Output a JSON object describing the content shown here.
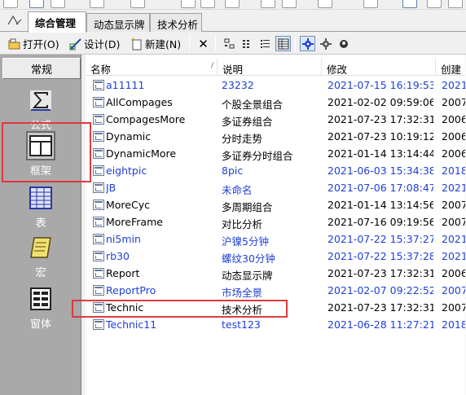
{
  "tabs": [
    "综合管理",
    "动态显示牌",
    "技术分析"
  ],
  "toolbar": {
    "open": "打开(O)",
    "design": "设计(D)",
    "new": "新建(N)"
  },
  "left_panel": {
    "header": "常规",
    "items": [
      "公式",
      "框架",
      "表",
      "宏",
      "窗体"
    ]
  },
  "columns": [
    "名称",
    "说明",
    "修改",
    "创建"
  ],
  "rows": [
    {
      "name": "a11111",
      "desc": "23232",
      "modified": "2021-07-15 16:19:53",
      "created": "2021-",
      "blue": true
    },
    {
      "name": "AllCompages",
      "desc": "个股全景组合",
      "modified": "2021-02-02 09:59:06",
      "created": "2007-",
      "blue": false
    },
    {
      "name": "CompagesMore",
      "desc": "多证券组合",
      "modified": "2021-07-23 17:32:31",
      "created": "2006-",
      "blue": false
    },
    {
      "name": "Dynamic",
      "desc": "分时走势",
      "modified": "2021-07-23 10:19:12",
      "created": "2006-",
      "blue": false
    },
    {
      "name": "DynamicMore",
      "desc": "多证券分时组合",
      "modified": "2021-01-14 13:14:44",
      "created": "2006-",
      "blue": false
    },
    {
      "name": "eightpic",
      "desc": "8pic",
      "modified": "2021-06-03 15:34:38",
      "created": "2018-",
      "blue": true
    },
    {
      "name": "JB",
      "desc": "未命名",
      "modified": "2021-07-06 17:08:47",
      "created": "2021-",
      "blue": true
    },
    {
      "name": "MoreCyc",
      "desc": "多周期组合",
      "modified": "2021-01-14 13:14:56",
      "created": "2007-",
      "blue": false
    },
    {
      "name": "MoreFrame",
      "desc": "对比分析",
      "modified": "2021-07-16 09:19:56",
      "created": "2007-",
      "blue": false
    },
    {
      "name": "ni5min",
      "desc": "沪镍5分钟",
      "modified": "2021-07-22 15:37:27",
      "created": "2021-",
      "blue": true
    },
    {
      "name": "rb30",
      "desc": "螺纹30分钟",
      "modified": "2021-07-22 15:37:28",
      "created": "2021-",
      "blue": true
    },
    {
      "name": "Report",
      "desc": "动态显示牌",
      "modified": "2021-07-23 17:32:31",
      "created": "2006-",
      "blue": false
    },
    {
      "name": "ReportPro",
      "desc": "市场全景",
      "modified": "2021-02-07 09:22:52",
      "created": "2007-",
      "blue": true
    },
    {
      "name": "Technic",
      "desc": "技术分析",
      "modified": "2021-07-23 17:32:31",
      "created": "2007-",
      "blue": false
    },
    {
      "name": "Technic11",
      "desc": "test123",
      "modified": "2021-06-28 11:27:21",
      "created": "2018-",
      "blue": true
    }
  ],
  "colors": {
    "accent_blue": "#1f3fd6",
    "highlight_red": "#e0393e",
    "panel_gray": "#a9a9a9"
  }
}
